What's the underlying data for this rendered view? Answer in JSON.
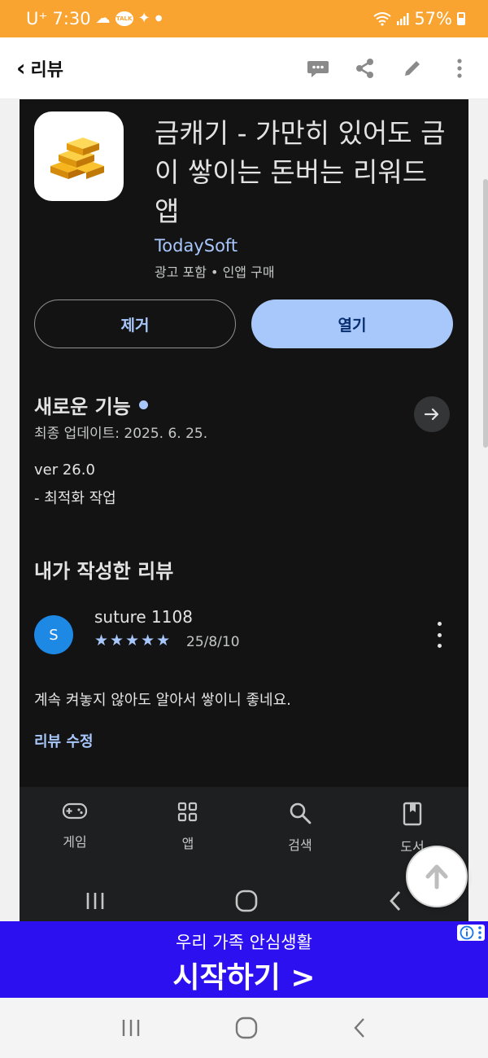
{
  "status_bar": {
    "carrier": "U⁺",
    "time": "7:30",
    "battery": "57%"
  },
  "app_bar": {
    "back_label": "리뷰"
  },
  "app": {
    "title": "금캐기 - 가만히 있어도 금이 쌓이는 돈버는 리워드 앱",
    "developer": "TodaySoft",
    "meta": "광고 포함 • 인앱 구매",
    "remove_label": "제거",
    "open_label": "열기"
  },
  "whats_new": {
    "title": "새로운 기능",
    "updated": "최종 업데이트: 2025. 6. 25.",
    "version": "ver 26.0",
    "note": "- 최적화 작업"
  },
  "my_review": {
    "title": "내가 작성한 리뷰",
    "avatar_letter": "S",
    "name": "suture 1108",
    "stars": "★★★★★",
    "rating": 5,
    "date": "25/8/10",
    "text": "계속 켜놓지 않아도 알아서 쌓이니 좋네요.",
    "edit_label": "리뷰 수정"
  },
  "bottom_nav": {
    "items": [
      {
        "label": "게임",
        "icon": "gamepad-icon"
      },
      {
        "label": "앱",
        "icon": "apps-grid-icon"
      },
      {
        "label": "검색",
        "icon": "search-icon"
      },
      {
        "label": "도서",
        "icon": "book-icon"
      }
    ]
  },
  "ad": {
    "line1": "우리 가족 안심생활",
    "line2": "시작하기 >"
  },
  "colors": {
    "status_bar": "#f9a431",
    "dark_bg": "#131314",
    "accent": "#a8c7fa",
    "ad_bg": "#2d10f0"
  }
}
